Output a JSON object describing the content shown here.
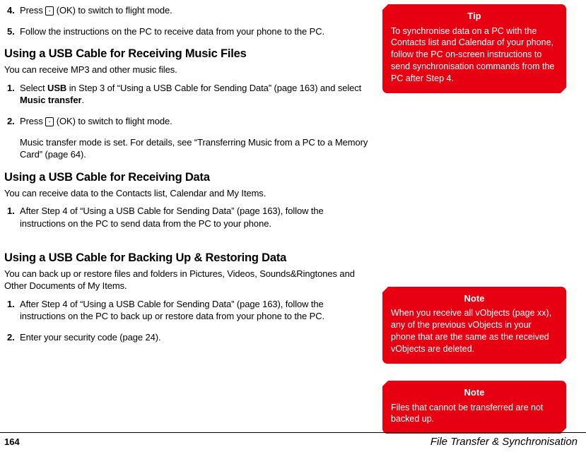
{
  "main": {
    "topSteps": [
      {
        "num": "4.",
        "pre": "Press ",
        "key": "-",
        "post": " (OK) to switch to flight mode."
      },
      {
        "num": "5.",
        "text": "Follow the instructions on the PC to receive data from your phone to the PC."
      }
    ],
    "s1": {
      "heading": "Using a USB Cable for Receiving Music Files",
      "intro": "You can receive MP3 and other music files.",
      "steps": [
        {
          "num": "1.",
          "pre": "Select ",
          "b1": "USB",
          "mid": " in Step 3 of “Using a USB Cable for Sending Data” (page 163) and select ",
          "b2": "Music transfer",
          "post": "."
        },
        {
          "num": "2.",
          "pre": "Press ",
          "key": "-",
          "post": " (OK) to switch to flight mode."
        }
      ],
      "sub": "Music transfer mode is set. For details, see “Transferring Music from a PC to a Memory Card” (page 64)."
    },
    "s2": {
      "heading": "Using a USB Cable for Receiving Data",
      "intro": "You can receive data to the Contacts list, Calendar and My Items.",
      "steps": [
        {
          "num": "1.",
          "text": "After Step 4 of “Using a USB Cable for Sending Data” (page 163), follow the instructions on the PC to send data from the PC to your phone."
        }
      ]
    },
    "s3": {
      "heading": "Using a USB Cable for Backing Up & Restoring Data",
      "intro": "You can back up or restore files and folders in Pictures, Videos, Sounds&Ringtones and Other Documents of My Items.",
      "steps": [
        {
          "num": "1.",
          "text": "After Step 4 of “Using a USB Cable for Sending Data” (page 163), follow the instructions on the PC to back up or restore data from your phone to the PC."
        },
        {
          "num": "2.",
          "text": "Enter your security code (page 24)."
        }
      ]
    }
  },
  "side": {
    "tip": {
      "title": "Tip",
      "body": "To synchronise data on a PC with the Contacts list and Calendar of your phone, follow the PC on-screen instructions to send synchronisation commands from the PC after Step 4."
    },
    "note1": {
      "title": "Note",
      "body": "When you receive all vObjects (page xx), any of the previous vObjects in your phone that are the same as the received vObjects are deleted."
    },
    "note2": {
      "title": "Note",
      "body": "Files that cannot be transferred are not backed up."
    }
  },
  "footer": {
    "page": "164",
    "chapter": "File Transfer & Synchronisation"
  }
}
